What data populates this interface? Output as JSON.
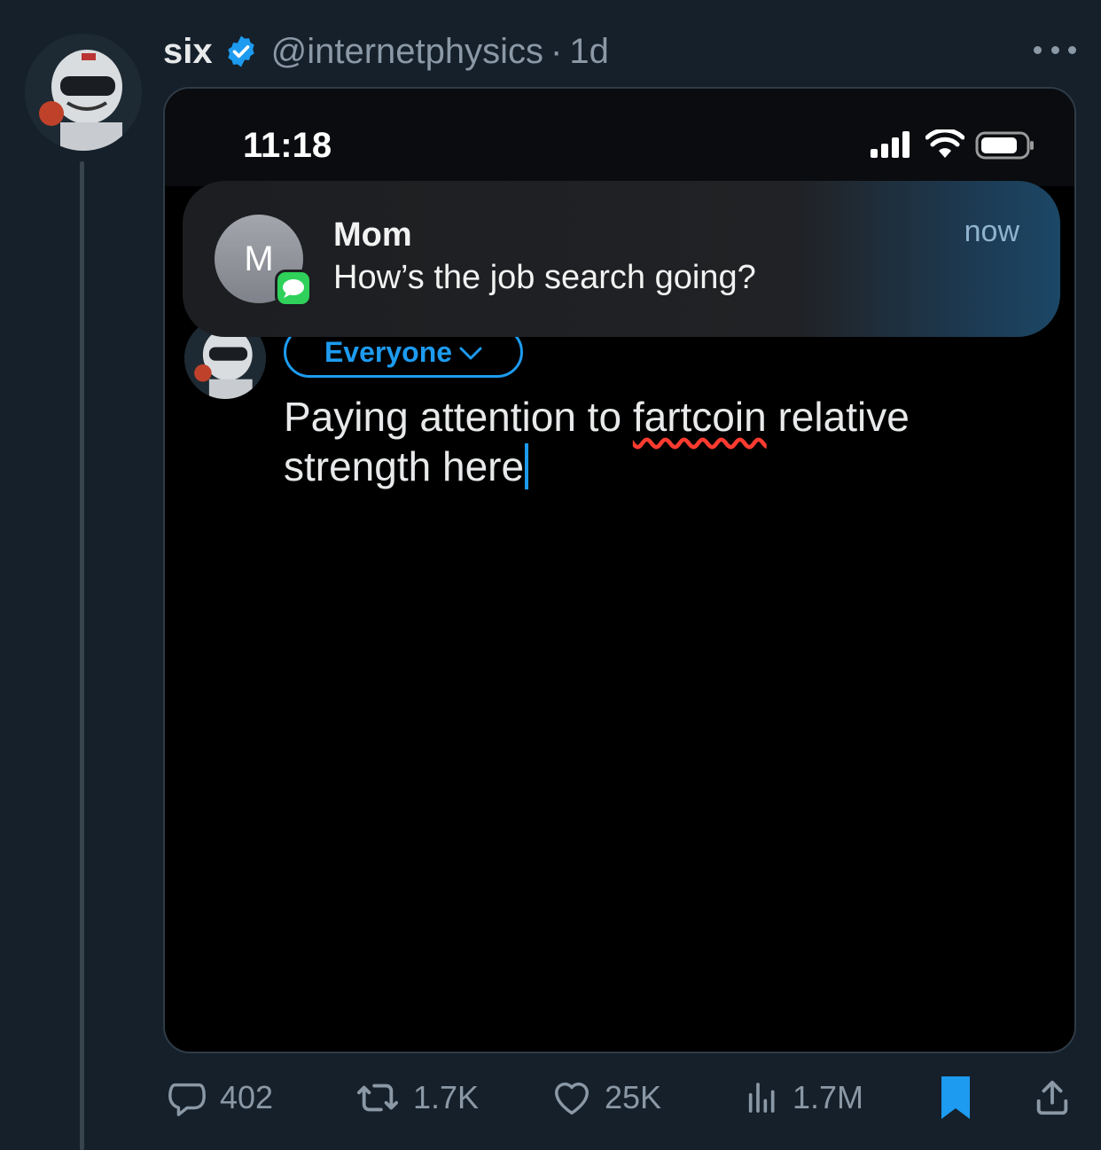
{
  "tweet": {
    "display_name": "six",
    "handle": "@internetphysics",
    "separator": "·",
    "time": "1d",
    "verified_icon": "verified-badge-icon",
    "more_icon": "more-icon"
  },
  "screenshot": {
    "clock": "11:18",
    "notification": {
      "avatar_letter": "M",
      "title": "Mom",
      "body": "How’s the job search going?",
      "time": "now"
    },
    "audience_label": "Everyone",
    "post_text_before": "Paying attention to ",
    "post_text_misspelled": "fartcoin",
    "post_text_after": " relative strength here"
  },
  "actions": {
    "replies": "402",
    "reposts": "1.7K",
    "likes": "25K",
    "views": "1.7M"
  },
  "colors": {
    "background": "#15202b",
    "accent": "#1d9bf0",
    "muted": "#8b98a5"
  }
}
